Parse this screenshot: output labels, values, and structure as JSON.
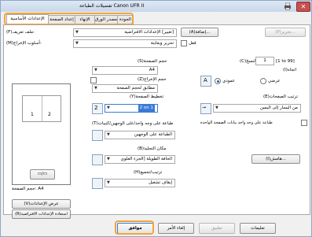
{
  "window": {
    "title": "تفضيلات الطباعة Canon UFR II",
    "close_glyph": "✕"
  },
  "tabs": [
    {
      "label": "الإعدادات الأساسية",
      "active": true
    },
    {
      "label": "إعداد الصفحة",
      "active": false
    },
    {
      "label": "الإنهاء",
      "active": false
    },
    {
      "label": "مصدر الورق",
      "active": false
    },
    {
      "label": "الجودة",
      "active": false
    }
  ],
  "profile": {
    "label": "(F)ملف تعريف:",
    "value": "تغيير] الإعدادات الافتراضية]",
    "add": "(A)إضافة...",
    "edit": "(P)تحرير..."
  },
  "output": {
    "label": "(M)أسلوب الإخراج:",
    "value": "تحرير وبعاينة",
    "lock_label": "قفل"
  },
  "page_size": {
    "label": "(S)حجم الصفحة",
    "value": "A4"
  },
  "output_size": {
    "label": "(Z)حجم الإخراج",
    "value": "مطابق لحجم الصفحة"
  },
  "copies": {
    "label": "(C)عدد النسخ:",
    "value": "1",
    "range": "[1 to 99]"
  },
  "orientation": {
    "label": "(I)اتجاه",
    "portrait": "عمودي",
    "landscape": "عرضي"
  },
  "layout": {
    "label": "(Y)تخطيط الصفحة",
    "value": "2 on 1"
  },
  "page_order": {
    "label": "(E)ترتيب الصفحات",
    "value": "من اليسار إلى اليمين"
  },
  "duplex": {
    "label": "(T)طباعة على وجه واحد/على الوجهين/كتيبات",
    "value": "الطباعة على الوجهين",
    "same_side_label": "طباعة على وجه واحد بيانات الصفحة الواحدة"
  },
  "binding": {
    "label": "(B)مكان التجليد",
    "value": "الحافة الطويلة [الجزء العلوي",
    "margin_button": "(I)هامش..."
  },
  "collate": {
    "label": "(H)ترتيب/تجميع",
    "value": "إيقاف تشغيل"
  },
  "preview": {
    "caption": "حجم الصفحة: A4",
    "page1": "1",
    "page2": "2"
  },
  "side_buttons": {
    "view_settings": "(V)عرض الإعدادات",
    "restore_defaults": "(R)استعادة الإعدادات الافتراضية"
  },
  "footer": {
    "ok": "موافق",
    "cancel": "إلغاء الأمر",
    "apply": "تطبيق",
    "help": "تعليمات"
  }
}
